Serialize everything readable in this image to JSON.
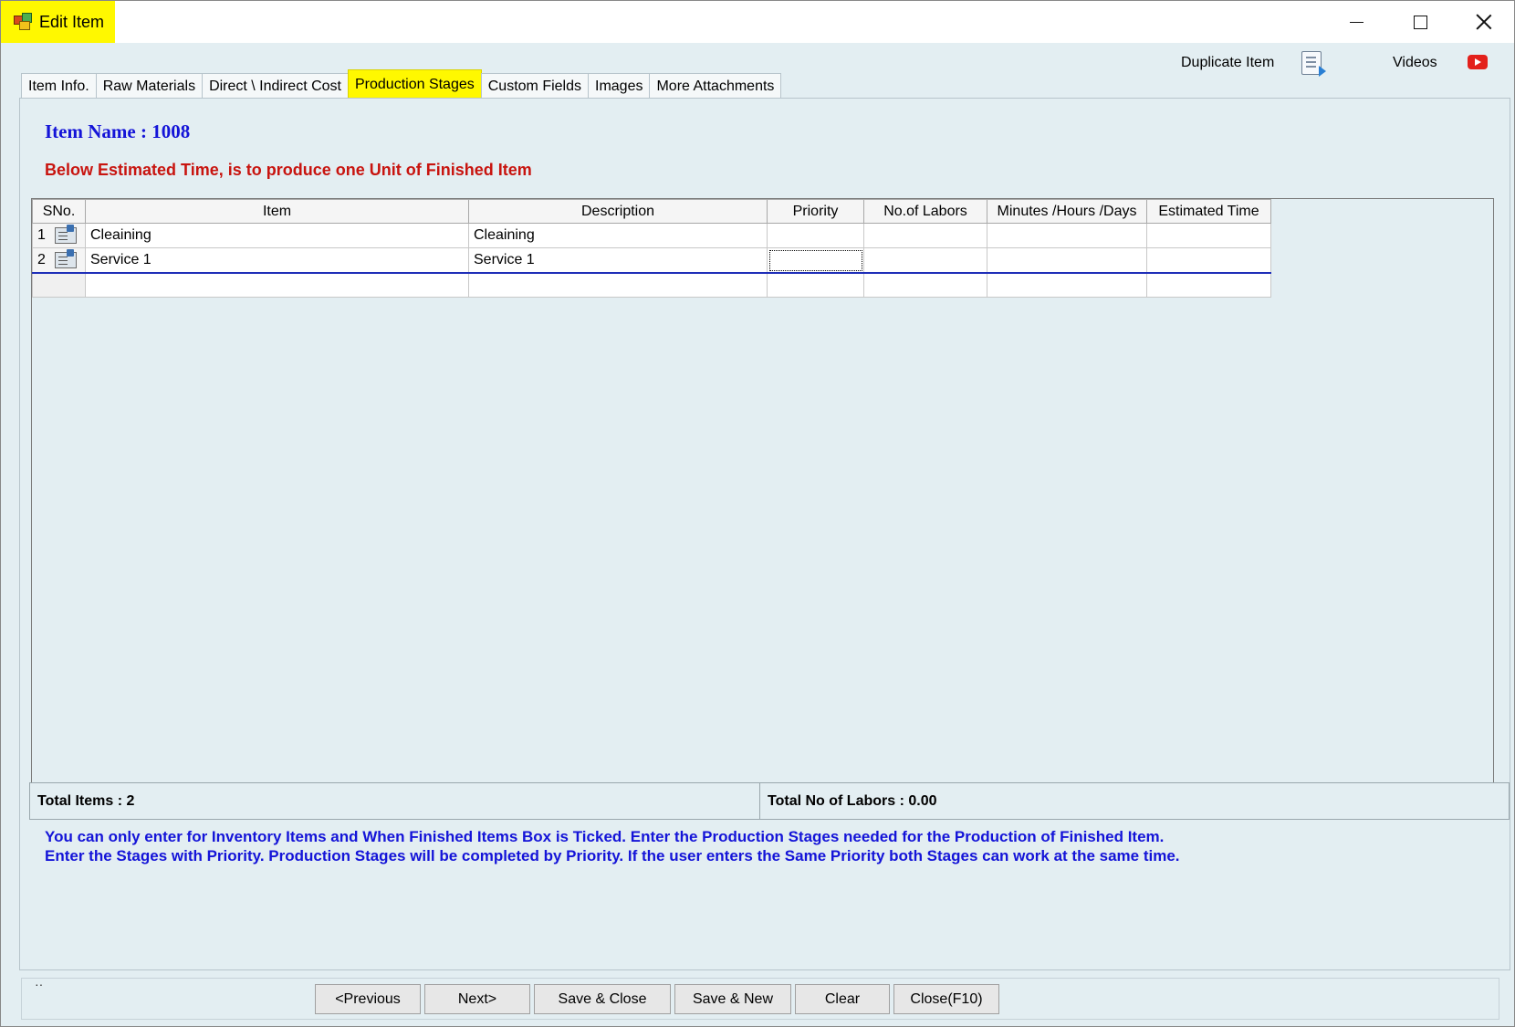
{
  "window": {
    "title": "Edit Item"
  },
  "toplinks": {
    "duplicate_label": "Duplicate Item",
    "videos_label": "Videos"
  },
  "tabs": [
    {
      "label": "Item Info."
    },
    {
      "label": "Raw Materials"
    },
    {
      "label": "Direct \\ Indirect Cost"
    },
    {
      "label": "Production Stages",
      "active": true
    },
    {
      "label": "Custom Fields"
    },
    {
      "label": "Images"
    },
    {
      "label": "More Attachments"
    }
  ],
  "header": {
    "item_name": "Item Name : 1008",
    "note": "Below Estimated Time, is to produce one Unit of Finished Item"
  },
  "grid": {
    "columns": [
      "SNo.",
      "Item",
      "Description",
      "Priority",
      "No.of Labors",
      "Minutes /Hours /Days",
      "Estimated Time"
    ],
    "rows": [
      {
        "sno": "1",
        "item": "Cleaining",
        "description": "Cleaining",
        "priority": "",
        "labors": "",
        "unit": "",
        "estimated": ""
      },
      {
        "sno": "2",
        "item": "Service 1",
        "description": "Service 1",
        "priority": "",
        "labors": "",
        "unit": "",
        "estimated": ""
      }
    ]
  },
  "totals": {
    "items": "Total Items : 2",
    "labors": "Total No of Labors : 0.00"
  },
  "info": {
    "line1": "You can only enter for Inventory Items and When Finished Items Box is Ticked. Enter the Production Stages needed for the Production of Finished Item.",
    "line2": "Enter the Stages with Priority. Production Stages will be completed by Priority. If the user enters the Same Priority both Stages can work at the same time."
  },
  "buttons": {
    "previous": "<Previous",
    "next": "Next>",
    "save_close": "Save & Close",
    "save_new": "Save & New",
    "clear": "Clear",
    "close": "Close(F10)"
  },
  "icons": {
    "app": "app-icon",
    "duplicate": "duplicate-icon",
    "videos": "youtube-icon",
    "row": "item-lookup-icon"
  },
  "colors": {
    "highlight": "#fff800",
    "item_name": "#1414d8",
    "note": "#c8140f",
    "info": "#1414d8"
  }
}
